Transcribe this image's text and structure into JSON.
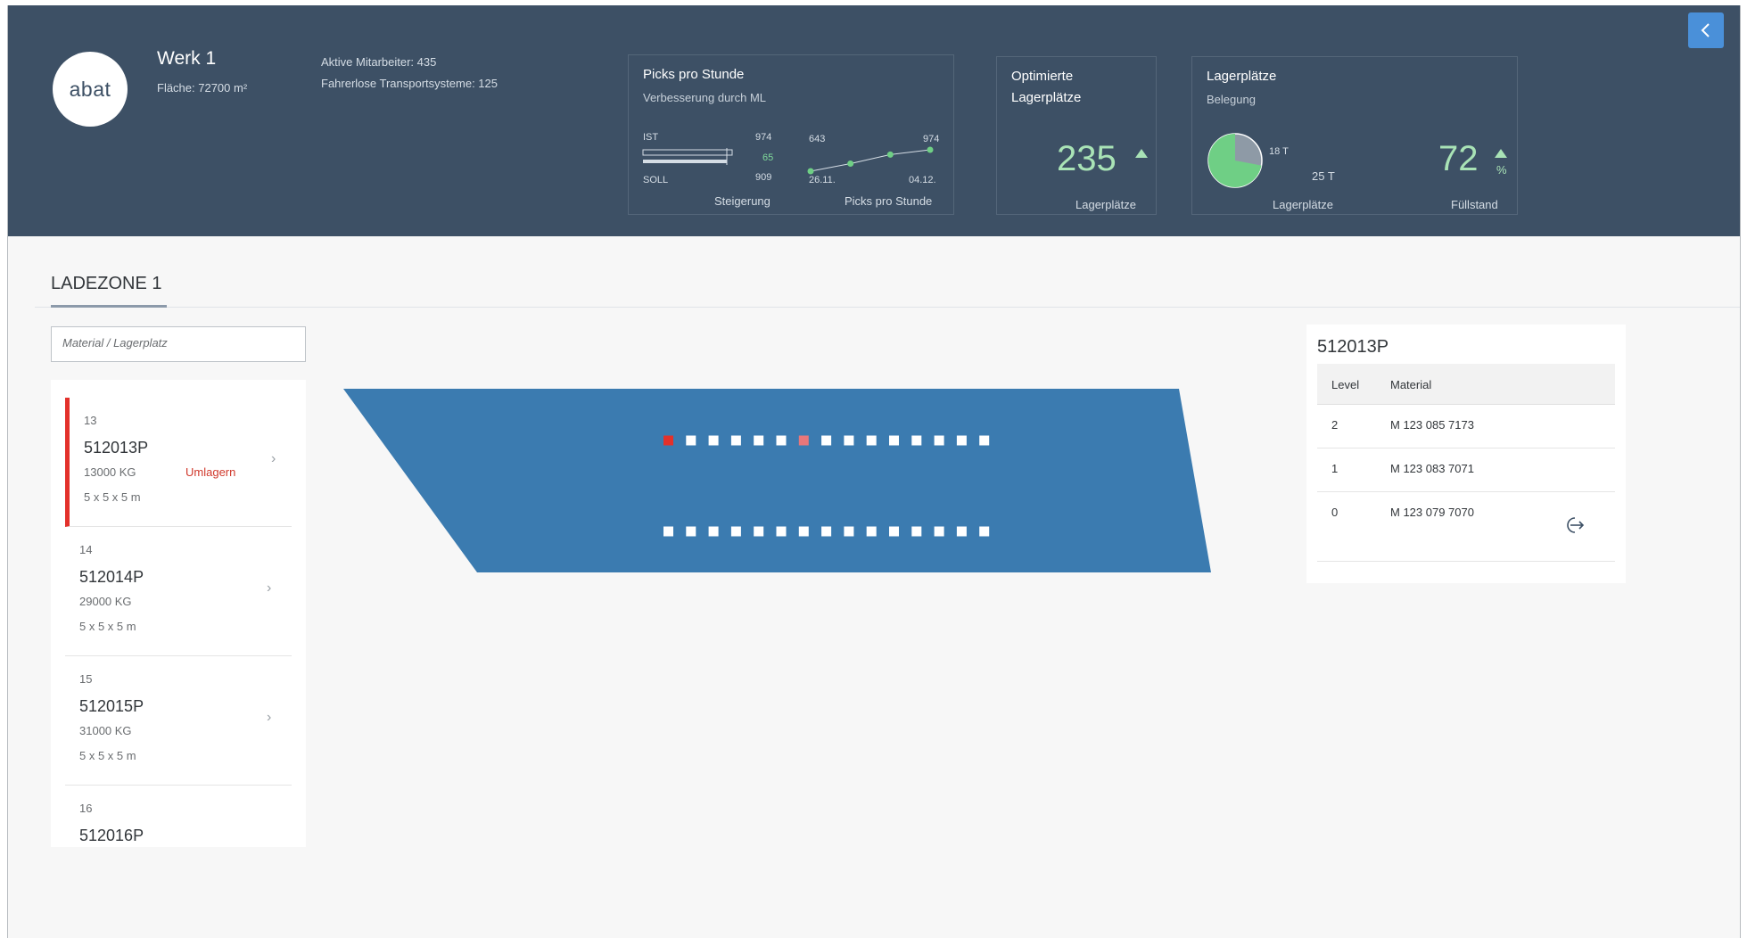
{
  "header": {
    "logo_text": "abat",
    "plant_title": "Werk 1",
    "plant_area": "Fläche: 72700 m²",
    "active_employees": "Aktive Mitarbeiter: 435",
    "transport_systems": "Fahrerlose Transportsysteme: 125"
  },
  "picks_tile": {
    "title": "Picks pro Stunde",
    "subtitle": "Verbesserung durch ML",
    "ist_label": "IST",
    "ist_value": "974",
    "delta_value": "65",
    "soll_label": "SOLL",
    "soll_value": "909",
    "left_footer": "Steigerung",
    "spark_start_value": "643",
    "spark_end_value": "974",
    "spark_start_date": "26.11.",
    "spark_end_date": "04.12.",
    "right_footer": "Picks pro Stunde",
    "sparkline": [
      643,
      760,
      900,
      974
    ],
    "bullet": {
      "actual": 974,
      "target": 909
    }
  },
  "optimized_tile": {
    "title": "Optimierte Lagerplätze",
    "value": "235",
    "trend": "up",
    "footer": "Lagerplätze"
  },
  "storage_tile": {
    "title": "Lagerplätze",
    "subtitle": "Belegung",
    "pie_label_small": "18 T",
    "pie_label_total": "25 T",
    "pie_fraction": 0.72,
    "pie_footer": "Lagerplätze",
    "fill_value": "72",
    "fill_unit": "%",
    "trend": "up",
    "fill_footer": "Füllstand"
  },
  "colors": {
    "header_bg": "#3d5065",
    "accent_blue": "#4a90d9",
    "kpi_green": "#a9e3b6",
    "spark_green": "#6fcf85",
    "zone_blue": "#3b7bb0",
    "alert_red": "#e3312b",
    "alert_light": "#e8777a"
  },
  "section": {
    "title": "LADEZONE 1"
  },
  "search": {
    "placeholder": "Material / Lagerplatz"
  },
  "list": {
    "items": [
      {
        "num": "13",
        "id": "512013P",
        "weight": "13000 KG",
        "dims": "5 x 5 x 5 m",
        "flag": "Umlagern",
        "selected": true
      },
      {
        "num": "14",
        "id": "512014P",
        "weight": "29000 KG",
        "dims": "5 x 5 x 5 m",
        "flag": "",
        "selected": false
      },
      {
        "num": "15",
        "id": "512015P",
        "weight": "31000 KG",
        "dims": "5 x 5 x 5 m",
        "flag": "",
        "selected": false
      },
      {
        "num": "16",
        "id": "512016P",
        "weight": "",
        "dims": "",
        "flag": "",
        "selected": false
      }
    ]
  },
  "zone_map": {
    "rows": [
      {
        "slots": [
          "selected",
          "free",
          "free",
          "free",
          "free",
          "free",
          "highlight",
          "free",
          "free",
          "free",
          "free",
          "free",
          "free",
          "free",
          "free"
        ]
      },
      {
        "slots": [
          "free",
          "free",
          "free",
          "free",
          "free",
          "free",
          "free",
          "free",
          "free",
          "free",
          "free",
          "free",
          "free",
          "free",
          "free"
        ]
      }
    ]
  },
  "detail": {
    "title": "512013P",
    "col_level": "Level",
    "col_material": "Material",
    "rows": [
      {
        "level": "2",
        "material": "M 123 085 7173"
      },
      {
        "level": "1",
        "material": "M 123 083 7071"
      },
      {
        "level": "0",
        "material": "M 123 079 7070"
      }
    ]
  }
}
